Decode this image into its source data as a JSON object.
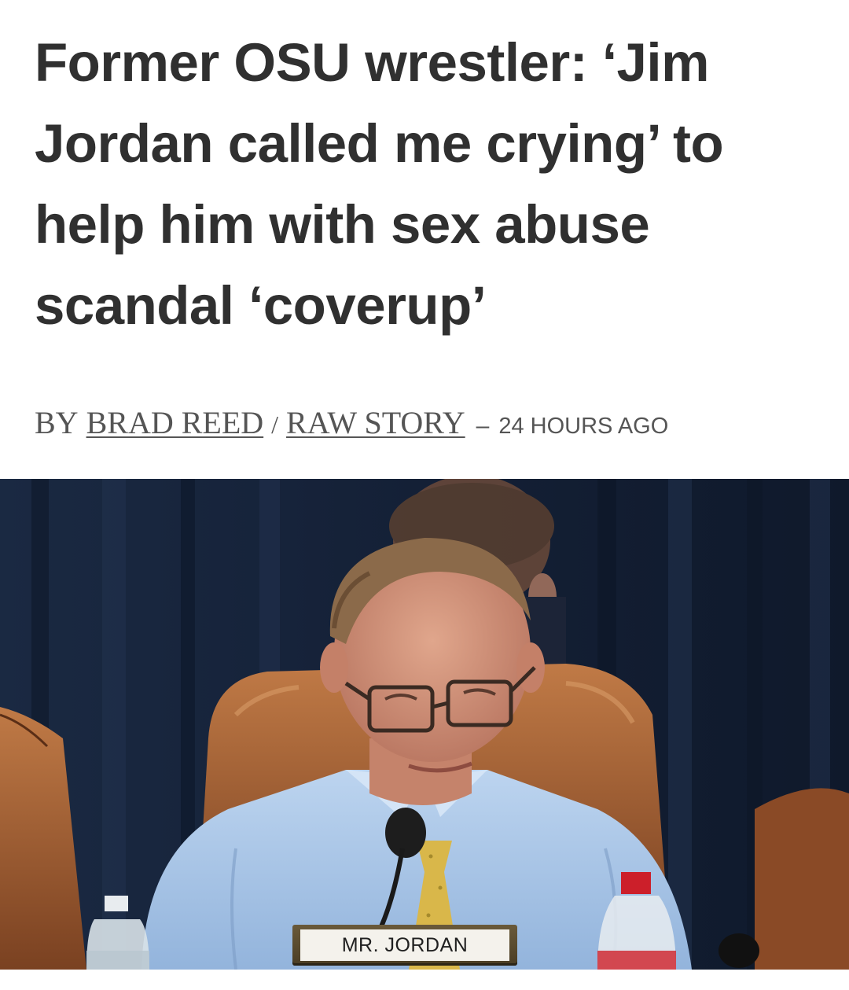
{
  "article": {
    "headline": "Former OSU wrestler: ‘Jim Jordan called me crying’ to help him with sex abuse scandal ‘coverup’",
    "byline": {
      "prefix": "BY",
      "author": "BRAD REED",
      "separator": "/",
      "publication": "RAW STORY",
      "dash": "–",
      "time": "24 HOURS AGO"
    }
  },
  "photo": {
    "nameplate": "MR. JORDAN"
  },
  "colors": {
    "headline": "#303030",
    "byline": "#555555",
    "curtain": "#16233a",
    "shirt": "#a9c7e8",
    "chair": "#a9663a"
  }
}
